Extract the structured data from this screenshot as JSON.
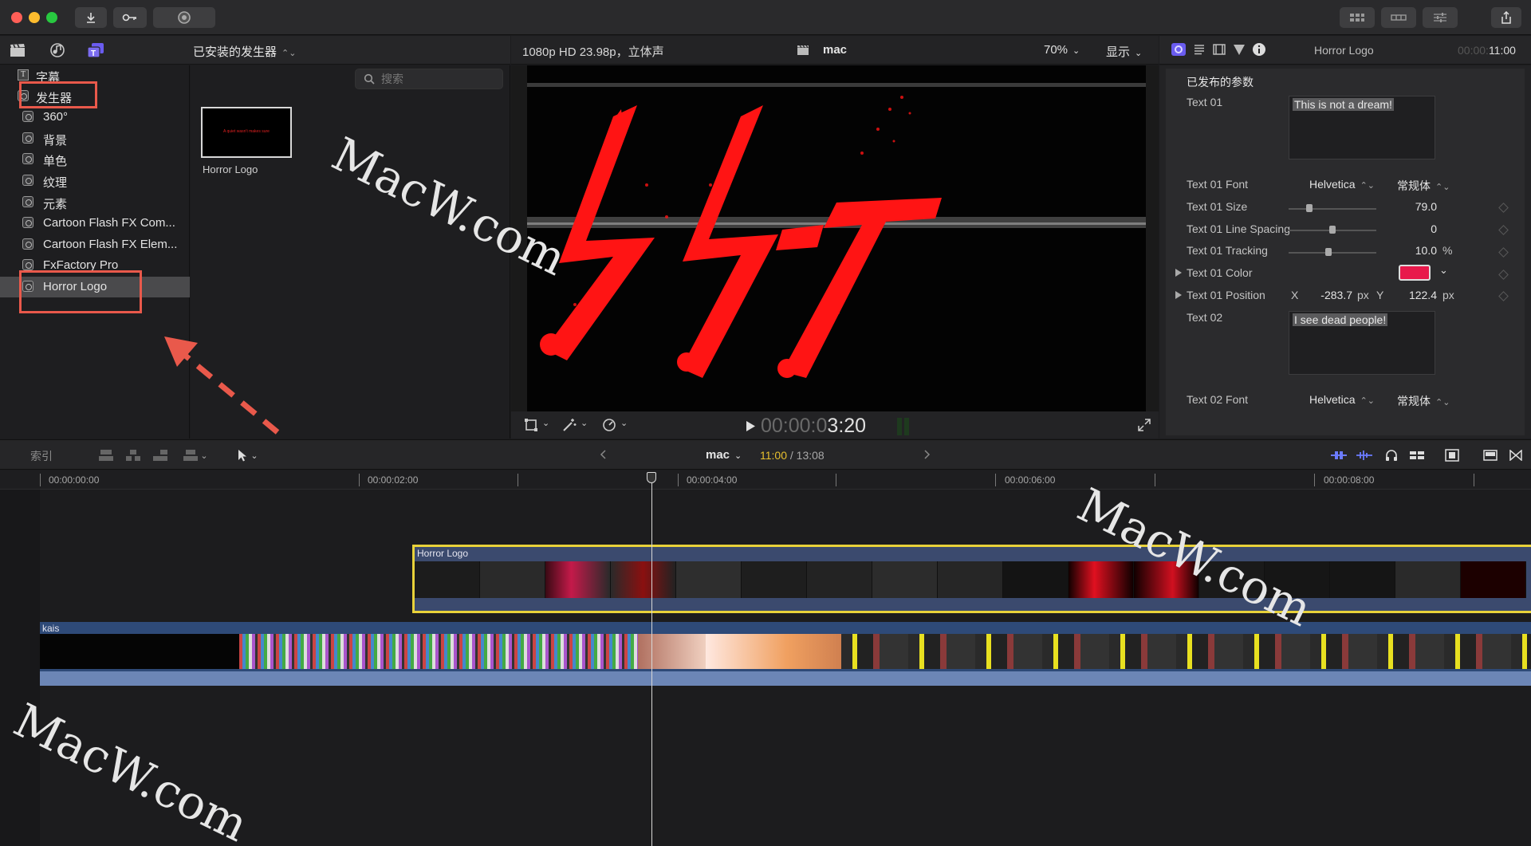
{
  "toolbar": {
    "import_icon": "download-icon",
    "keywords_icon": "key-icon",
    "bg_tasks_icon": "gauge-icon",
    "share_icon": "share-icon"
  },
  "library": {
    "title": "已安装的发生器",
    "search_placeholder": "搜索",
    "categories": [
      {
        "label": "字幕",
        "expanded": false,
        "type": "title"
      },
      {
        "label": "发生器",
        "expanded": true,
        "type": "generator"
      }
    ],
    "items": [
      {
        "label": "360°"
      },
      {
        "label": "背景"
      },
      {
        "label": "单色"
      },
      {
        "label": "纹理"
      },
      {
        "label": "元素"
      },
      {
        "label": "Cartoon Flash FX Com..."
      },
      {
        "label": "Cartoon Flash FX Elem..."
      },
      {
        "label": "FxFactory Pro"
      },
      {
        "label": "Horror Logo",
        "selected": true
      }
    ],
    "thumbnail": {
      "label": "Horror Logo",
      "caption": "A quiet wasn't makes sure"
    }
  },
  "viewer": {
    "format": "1080p HD 23.98p，立体声",
    "project": "mac",
    "zoom": "70%",
    "display": "显示",
    "timecode_dim": "00:00:0",
    "timecode_bright": "3:20"
  },
  "inspector": {
    "title": "Horror Logo",
    "duration_dim": "00:00:",
    "duration": "11:00",
    "section": "已发布的参数",
    "text01_label": "Text 01",
    "text01_value": "This is not a dream!",
    "font_label": "Text 01 Font",
    "font_value": "Helvetica",
    "font_style": "常规体",
    "size_label": "Text 01 Size",
    "size_value": "79.0",
    "size_level": 0.22,
    "spacing_label": "Text 01 Line Spacing",
    "spacing_value": "0",
    "spacing_level": 0.5,
    "tracking_label": "Text 01 Tracking",
    "tracking_value": "10.0",
    "tracking_unit": "%",
    "tracking_level": 0.45,
    "color_label": "Text 01 Color",
    "color_value": "#e8194b",
    "position_label": "Text 01 Position",
    "x_label": "X",
    "x_value": "-283.7",
    "y_label": "Y",
    "y_value": "122.4",
    "px": "px",
    "text02_label": "Text 02",
    "text02_value": "I see dead people!",
    "font2_label": "Text 02 Font",
    "font2_value": "Helvetica",
    "font2_style": "常规体"
  },
  "timeline": {
    "index_label": "索引",
    "project": "mac",
    "position": "11:00",
    "total": "13:08",
    "ruler": [
      "00:00:00:00",
      "00:00:02:00",
      "00:00:04:00",
      "00:00:06:00",
      "00:00:08:00"
    ],
    "clip_top": "Horror Logo",
    "clip_main": "kais"
  },
  "watermark": "MacW.com",
  "colors": {
    "accent": "#7b6cf0",
    "selection": "#e8d23a",
    "annotation": "#e9594b",
    "horror_red": "#ff1a1a"
  }
}
